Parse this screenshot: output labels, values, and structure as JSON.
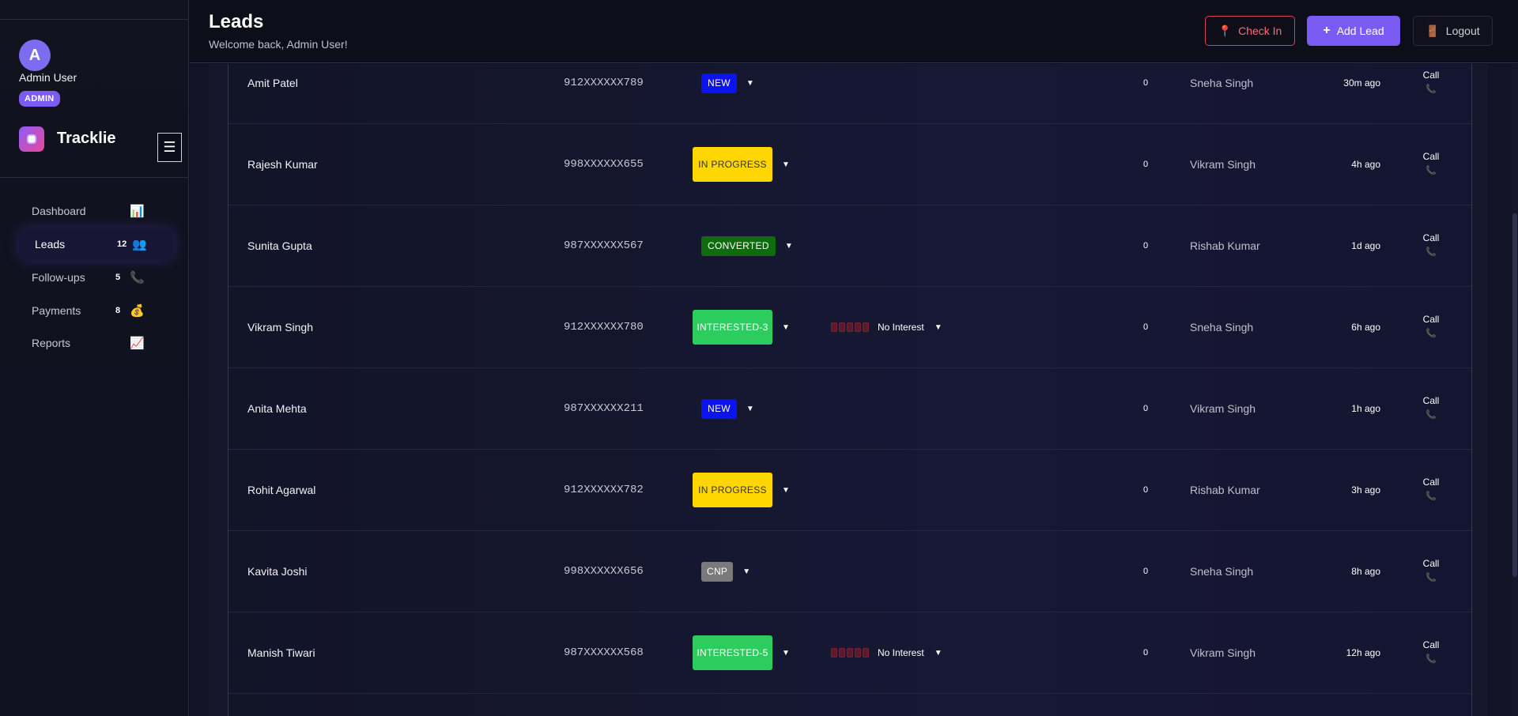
{
  "user": {
    "initial": "A",
    "name": "Admin User",
    "role": "ADMIN"
  },
  "brand": {
    "name": "Tracklie"
  },
  "menu_toggle_icon": "☰",
  "sidebar": {
    "items": [
      {
        "label": "Dashboard",
        "count": "",
        "icon": "📊",
        "icon_name": "bar-chart-icon"
      },
      {
        "label": "Leads",
        "count": "12",
        "icon": "👥",
        "icon_name": "people-icon",
        "active": true
      },
      {
        "label": "Follow-ups",
        "count": "5",
        "icon": "📞",
        "icon_name": "phone-icon"
      },
      {
        "label": "Payments",
        "count": "8",
        "icon": "💰",
        "icon_name": "money-bag-icon"
      },
      {
        "label": "Reports",
        "count": "",
        "icon": "📈",
        "icon_name": "trend-chart-icon"
      }
    ]
  },
  "header": {
    "title": "Leads",
    "subtitle": "Welcome back, Admin User!",
    "checkin_label": "Check In",
    "add_lead_label": "Add Lead",
    "logout_label": "Logout",
    "checkin_icon": "📍",
    "add_icon": "+",
    "logout_icon": "🚪"
  },
  "colors": {
    "accent": "#7a5cf5",
    "new": "#0d12f0",
    "in_progress": "#ffd600",
    "converted": "#0e6b0e",
    "interested": "#2dcc5e",
    "cnp": "#7a7a7a",
    "checkin": "#e0404e"
  },
  "leads": [
    {
      "name": "Amit Patel",
      "phone": "912XXXXXX789",
      "status": "NEW",
      "status_type": "new",
      "interest": "",
      "count": "0",
      "agent": "Sneha Singh",
      "time": "30m ago",
      "call_label": "Call",
      "call_icon": "📞"
    },
    {
      "name": "Rajesh Kumar",
      "phone": "998XXXXXX655",
      "status": "IN PROGRESS",
      "status_type": "progress",
      "interest": "",
      "count": "0",
      "agent": "Vikram Singh",
      "time": "4h ago",
      "call_label": "Call",
      "call_icon": "📞"
    },
    {
      "name": "Sunita Gupta",
      "phone": "987XXXXXX567",
      "status": "CONVERTED",
      "status_type": "converted",
      "interest": "",
      "count": "0",
      "agent": "Rishab Kumar",
      "time": "1d ago",
      "call_label": "Call",
      "call_icon": "📞"
    },
    {
      "name": "Vikram Singh",
      "phone": "912XXXXXX780",
      "status": "INTERESTED-3",
      "status_type": "interested",
      "interest": "No Interest",
      "count": "0",
      "agent": "Sneha Singh",
      "time": "6h ago",
      "call_label": "Call",
      "call_icon": "📞"
    },
    {
      "name": "Anita Mehta",
      "phone": "987XXXXXX211",
      "status": "NEW",
      "status_type": "new",
      "interest": "",
      "count": "0",
      "agent": "Vikram Singh",
      "time": "1h ago",
      "call_label": "Call",
      "call_icon": "📞"
    },
    {
      "name": "Rohit Agarwal",
      "phone": "912XXXXXX782",
      "status": "IN PROGRESS",
      "status_type": "progress",
      "interest": "",
      "count": "0",
      "agent": "Rishab Kumar",
      "time": "3h ago",
      "call_label": "Call",
      "call_icon": "📞"
    },
    {
      "name": "Kavita Joshi",
      "phone": "998XXXXXX656",
      "status": "CNP",
      "status_type": "cnp",
      "interest": "",
      "count": "0",
      "agent": "Sneha Singh",
      "time": "8h ago",
      "call_label": "Call",
      "call_icon": "📞"
    },
    {
      "name": "Manish Tiwari",
      "phone": "987XXXXXX568",
      "status": "INTERESTED-5",
      "status_type": "interested",
      "interest": "No Interest",
      "count": "0",
      "agent": "Vikram Singh",
      "time": "12h ago",
      "call_label": "Call",
      "call_icon": "📞"
    }
  ]
}
